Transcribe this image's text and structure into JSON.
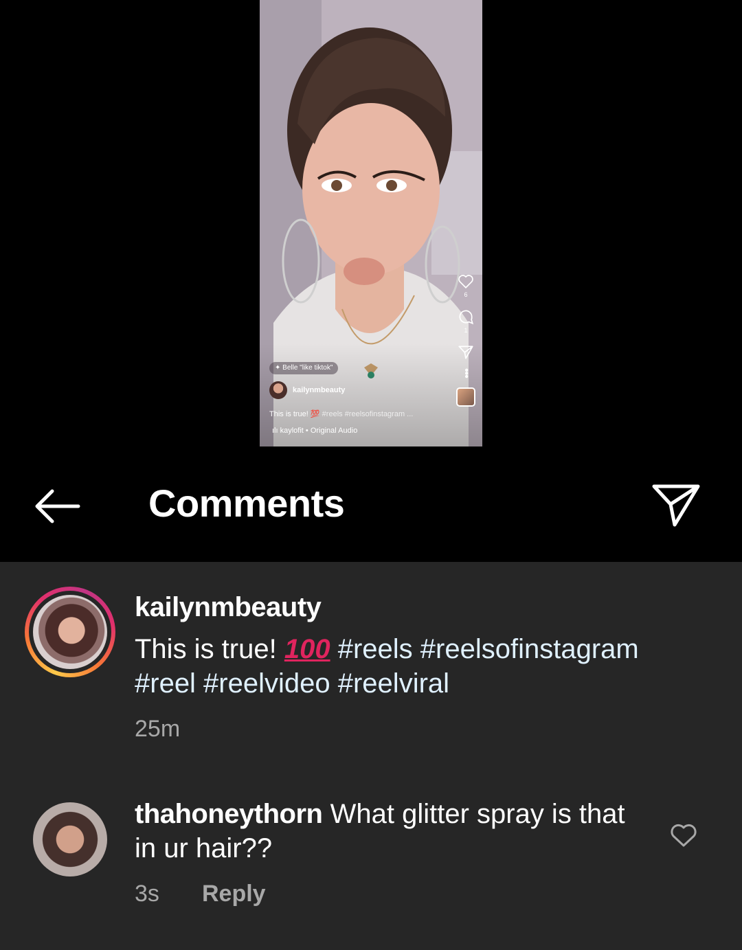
{
  "reel": {
    "effect_label": "Belle \"like tiktok\"",
    "username": "kailynmbeauty",
    "caption_text": "This is true! 💯",
    "caption_tags": "#reels #reelsofinstagram ...",
    "audio_label": "kaylofit • Original Audio",
    "like_count": "6",
    "comment_count": "1"
  },
  "header": {
    "title": "Comments"
  },
  "caption_comment": {
    "username": "kailynmbeauty",
    "text_prefix": "This is true! ",
    "emoji": "100",
    "line1_tags": "#reels #reelsofinstagram",
    "line2_tags": "#reel #reelvideo #reelviral",
    "time": "25m"
  },
  "comments": [
    {
      "username": "thahoneythorn",
      "text_line1": "What glitter spray is that",
      "text_line2": "in ur hair??",
      "time": "3s",
      "reply_label": "Reply"
    }
  ],
  "colors": {
    "background": "#262626",
    "header_background": "#000000",
    "meta_text": "#a8a8a8",
    "hashtag": "#e0f1ff"
  }
}
